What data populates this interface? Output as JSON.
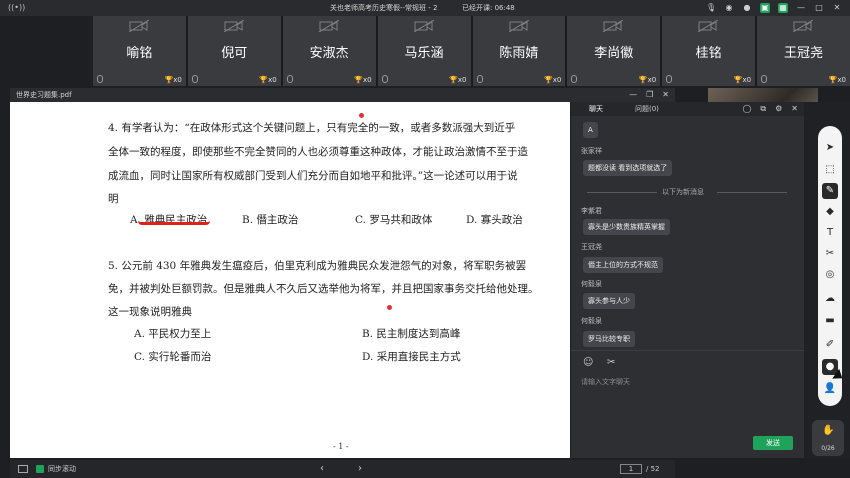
{
  "titlebar": {
    "signal_icon": "((•))",
    "title": "关也老师高考历史寒假--常规班 - 2",
    "elapsed": "已经开课: 06:48"
  },
  "participants": [
    {
      "name": "喻铭",
      "score": "x0"
    },
    {
      "name": "倪可",
      "score": "x0"
    },
    {
      "name": "安淑杰",
      "score": "x0"
    },
    {
      "name": "马乐涵",
      "score": "x0"
    },
    {
      "name": "陈雨婧",
      "score": "x0"
    },
    {
      "name": "李尚徽",
      "score": "x0"
    },
    {
      "name": "桂铭",
      "score": "x0"
    },
    {
      "name": "王冠尧",
      "score": "x0"
    }
  ],
  "pdf": {
    "filename": "世界史习题集.pdf",
    "q4_line1": "4. 有学者认为：“在政体形式这个关键问题上，只有完全的一致，或者多数派强大到近乎",
    "q4_line2": "全体一致的程度，即使那些不完全赞同的人也必须尊重这种政体，才能让政治激情不至于造",
    "q4_line3": "成流血，同时让国家所有权威部门受到人们充分而自如地平和批评。”这一论述可以用于说",
    "q4_line4": "明",
    "q4_options": [
      "A. 雅典民主政治",
      "B. 僭主政治",
      "C. 罗马共和政体",
      "D. 寡头政治"
    ],
    "q5_line1": "5. 公元前 430 年雅典发生瘟疫后，伯里克利成为雅典民众发泄怨气的对象，将军职务被罢",
    "q5_line2": "免，并被判处巨额罚款。但是雅典人不久后又选举他为将军，并且把国家事务交托给他处理。",
    "q5_line3": "这一现象说明雅典",
    "q5_options": [
      "A. 平民权力至上",
      "B. 民主制度达到高峰",
      "C. 实行轮番而治",
      "D. 采用直接民主方式"
    ],
    "page_label": "- 1 -",
    "current_page": "1",
    "total_pages": "/ 52"
  },
  "bottombar": {
    "sync_label": "同步滚动"
  },
  "chat": {
    "tab_chat": "聊天",
    "tab_questions": "问题(0)",
    "messages_before": [
      {
        "user": "",
        "text": "A"
      },
      {
        "user": "张家祥",
        "text": "题都没读 看到选项就选了"
      }
    ],
    "divider": "以下为新消息",
    "messages_after": [
      {
        "user": "李紫君",
        "text": "寡头是少数贵族精英掌握"
      },
      {
        "user": "王冠尧",
        "text": "僭主上位的方式不规范"
      },
      {
        "user": "何毅泉",
        "text": "寡头参与人少"
      },
      {
        "user": "何毅泉",
        "text": "罗马比较专职"
      }
    ],
    "input_placeholder": "请输入文字聊天",
    "send_label": "发送"
  },
  "counter": {
    "text": "0/26"
  },
  "colors": {
    "accent_green": "#1fa35a",
    "annotation_red": "#e0201f",
    "trophy_gold": "#f2b60c"
  }
}
